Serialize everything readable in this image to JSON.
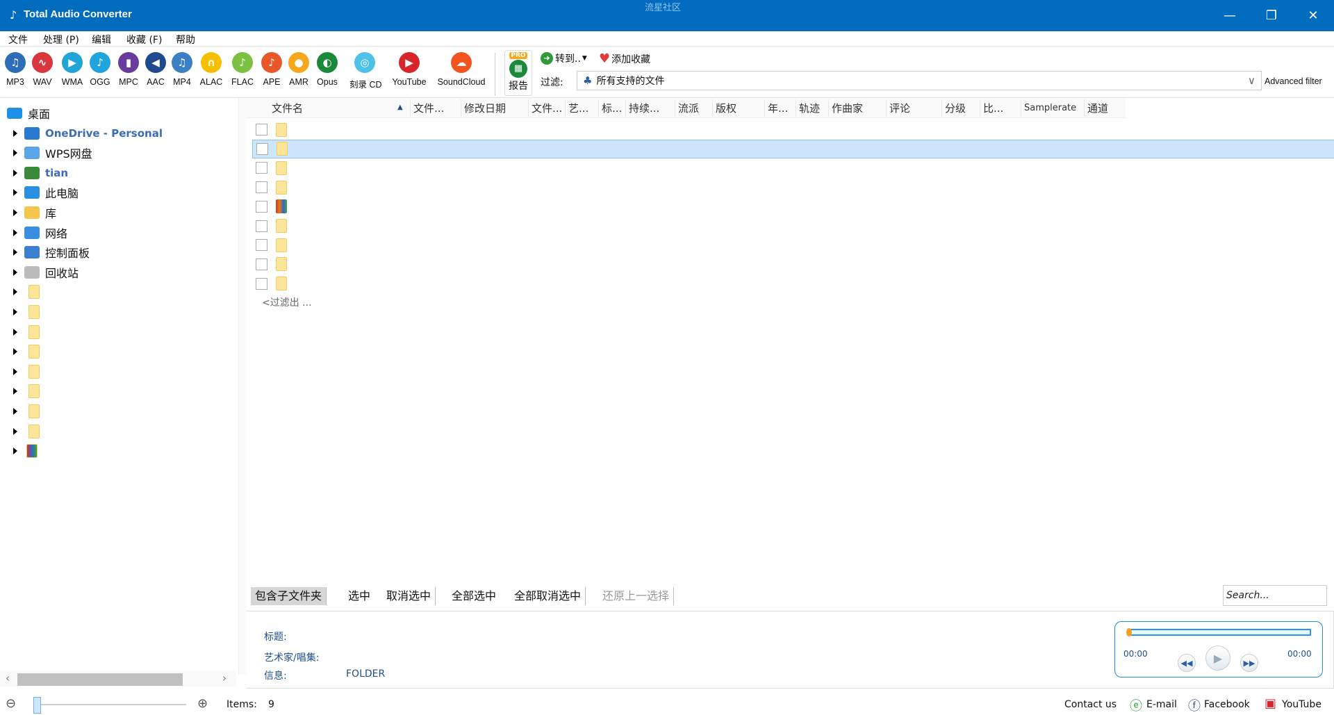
{
  "window": {
    "title": "Total Audio Converter",
    "watermark": "流星社区"
  },
  "menu": [
    "文件",
    "处理 (P)",
    "编辑",
    "收藏 (F)",
    "帮助"
  ],
  "formats": [
    {
      "label": "MP3",
      "color": "#2d6db5",
      "glyph": "♫"
    },
    {
      "label": "WAV",
      "color": "#d9363e",
      "glyph": "∿"
    },
    {
      "label": "WMA",
      "color": "#1fa5d8",
      "glyph": "▶"
    },
    {
      "label": "OGG",
      "color": "#20a4dc",
      "glyph": "♪"
    },
    {
      "label": "MPC",
      "color": "#6a3a9c",
      "glyph": "▮"
    },
    {
      "label": "AAC",
      "color": "#1f4b8e",
      "glyph": "◀"
    },
    {
      "label": "MP4",
      "color": "#3b7fc4",
      "glyph": "♫"
    },
    {
      "label": "ALAC",
      "color": "#f6c000",
      "glyph": "∩"
    },
    {
      "label": "FLAC",
      "color": "#7cc242",
      "glyph": "♪"
    },
    {
      "label": "APE",
      "color": "#e8572a",
      "glyph": "♪"
    },
    {
      "label": "AMR",
      "color": "#f5a81c",
      "glyph": "●"
    },
    {
      "label": "Opus",
      "color": "#1a8a3a",
      "glyph": "◐"
    },
    {
      "label": "刻录 CD",
      "color": "#4ec1e8",
      "glyph": "◎"
    },
    {
      "label": "YouTube",
      "color": "#d8252b",
      "glyph": "▶"
    },
    {
      "label": "SoundCloud",
      "color": "#f2531f",
      "glyph": "☁"
    }
  ],
  "toolbar": {
    "report": "报告",
    "pro_badge": "PRO",
    "goto": "转到..",
    "favorite": "添加收藏",
    "filter_label": "过滤:",
    "filter_value": "所有支持的文件",
    "advanced_filter": "Advanced filter"
  },
  "tree": {
    "root": "桌面",
    "items": [
      "OneDrive - Personal",
      "WPS网盘",
      "tian",
      "此电脑",
      "库",
      "网络",
      "控制面板",
      "回收站"
    ],
    "blurred_count": 9
  },
  "columns": [
    "文件名",
    "文件...",
    "修改日期",
    "文件...",
    "艺...",
    "标...",
    "持续...",
    "流派",
    "版权",
    "年...",
    "轨迹",
    "作曲家",
    "评论",
    "分级",
    "比...",
    "Samplerate",
    "通道"
  ],
  "rows": 9,
  "filtered_out": "<过滤出 ...",
  "bottom_buttons": [
    "包含子文件夹",
    "选中",
    "取消选中",
    "全部选中",
    "全部取消选中",
    "还原上一选择"
  ],
  "search_placeholder": "Search...",
  "info": {
    "title_label": "标题:",
    "artist_label": "艺术家/唱集:",
    "info_label": "信息:",
    "info_value": "FOLDER"
  },
  "player": {
    "elapsed": "00:00",
    "total": "00:00",
    "progress": 0
  },
  "status": {
    "items_label": "Items:",
    "items_count": "9",
    "contact": "Contact us",
    "email": "E-mail",
    "facebook": "Facebook",
    "youtube": "YouTube"
  },
  "colors": {
    "titlebar": "#016bbd",
    "selection": "#cde6fb"
  }
}
